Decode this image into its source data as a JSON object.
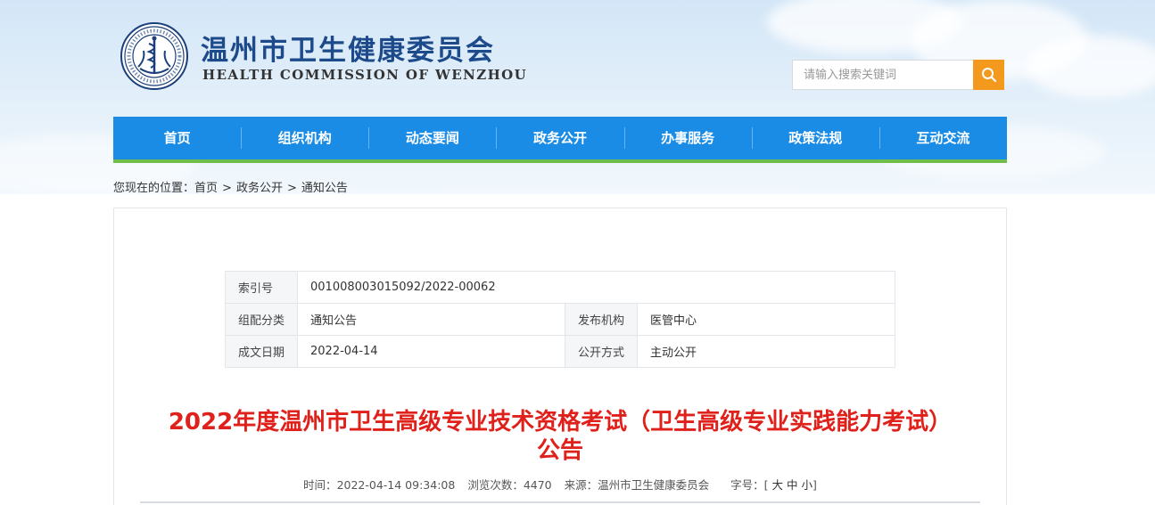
{
  "header": {
    "title": "温州市卫生健康委员会",
    "subtitle": "HEALTH COMMISSION OF WENZHOU",
    "emblem_icon": "health-commission-emblem-icon"
  },
  "search": {
    "placeholder": "请输入搜索关键词",
    "button_icon": "search-icon",
    "button_color": "#f39a1e"
  },
  "nav": {
    "color": "#1b8ce6",
    "underline_color": "#6fbe4b",
    "items": [
      "首页",
      "组织机构",
      "动态要闻",
      "政务公开",
      "办事服务",
      "政策法规",
      "互动交流"
    ]
  },
  "breadcrumb": {
    "prefix": "您现在的位置：",
    "items": [
      "首页",
      "政务公开",
      "通知公告"
    ],
    "separator": ">"
  },
  "meta": {
    "index_label": "索引号",
    "index_value": "001008003015092/2022-00062",
    "category_label": "组配分类",
    "category_value": "通知公告",
    "publisher_label": "发布机构",
    "publisher_value": "医管中心",
    "date_label": "成文日期",
    "date_value": "2022-04-14",
    "disclosure_label": "公开方式",
    "disclosure_value": "主动公开"
  },
  "article": {
    "title_line1": "2022年度温州市卫生高级专业技术资格考试（卫生高级专业实践能力考试）",
    "title_line2": "公告",
    "title_color": "#e0201a",
    "time_label": "时间：",
    "time_value": "2022-04-14 09:34:08",
    "views_label": "浏览次数：",
    "views_value": "4470",
    "source_label": "来源：",
    "source_value": "温州市卫生健康委员会",
    "fontsize_label": "字号：",
    "fontsize_open": "[",
    "fontsize_large": "大",
    "fontsize_medium": "中",
    "fontsize_small": "小",
    "fontsize_close": "]"
  }
}
